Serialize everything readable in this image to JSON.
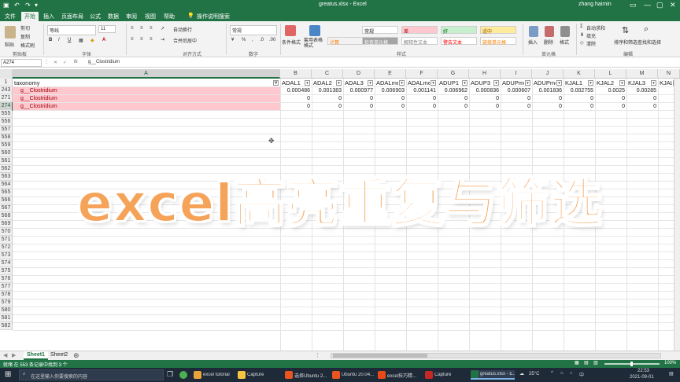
{
  "titlebar": {
    "document_title": "greatus.xlsx - Excel",
    "user": "zhang haimin"
  },
  "ribbon_tabs": [
    "文件",
    "开始",
    "插入",
    "页面布局",
    "公式",
    "数据",
    "审阅",
    "视图",
    "帮助",
    "操作说明搜索"
  ],
  "ribbon": {
    "clipboard_label": "剪贴板",
    "font_label": "字体",
    "align_label": "对齐方式",
    "number_label": "数字",
    "styles_label": "样式",
    "cells_label": "单元格",
    "edit_label": "编辑",
    "paste": "粘贴",
    "cut": "剪切",
    "copy": "复制",
    "format_painter": "格式刷",
    "font_name": "等线",
    "font_size": "11",
    "wrap_text": "自动换行",
    "merge_center": "合并后居中",
    "number_format": "常规",
    "conditional_format": "条件格式",
    "table_format": "套用表格格式",
    "styles": [
      {
        "label": "常规",
        "bg": "#ffffff",
        "fg": "#222222"
      },
      {
        "label": "差",
        "bg": "#ffc7ce",
        "fg": "#9c0006"
      },
      {
        "label": "好",
        "bg": "#c6efce",
        "fg": "#006100"
      },
      {
        "label": "适中",
        "bg": "#ffeb9c",
        "fg": "#9c5700"
      },
      {
        "label": "计算",
        "bg": "#f2f2f2",
        "fg": "#fa7d00"
      },
      {
        "label": "检查单元格",
        "bg": "#a5a5a5",
        "fg": "#ffffff"
      },
      {
        "label": "解释性文本",
        "bg": "#ffffff",
        "fg": "#7f7f7f"
      },
      {
        "label": "警告文本",
        "bg": "#ffffff",
        "fg": "#ff0000"
      },
      {
        "label": "链接单元格",
        "bg": "#ffffff",
        "fg": "#fa7d00"
      }
    ],
    "insert": "插入",
    "delete": "删除",
    "format": "格式",
    "autosum": "自动求和",
    "fill": "填充",
    "clear": "清除",
    "sort_filter": "排序和筛选",
    "find_select": "查找和选择"
  },
  "formula_bar": {
    "name_box": "A274",
    "fx": "fx",
    "formula": "g__Clostridium"
  },
  "columns": [
    {
      "letter": "A",
      "header": "taxonomy",
      "selected": true
    },
    {
      "letter": "B",
      "header": "ADAL1"
    },
    {
      "letter": "C",
      "header": "ADAL2"
    },
    {
      "letter": "D",
      "header": "ADAL3"
    },
    {
      "letter": "E",
      "header": "ADALme"
    },
    {
      "letter": "F",
      "header": "ADALme"
    },
    {
      "letter": "G",
      "header": "ADUP1"
    },
    {
      "letter": "H",
      "header": "ADUP3"
    },
    {
      "letter": "I",
      "header": "ADUPme"
    },
    {
      "letter": "J",
      "header": "ADUPme"
    },
    {
      "letter": "K",
      "header": "KJAL1"
    },
    {
      "letter": "L",
      "header": "KJAL2"
    },
    {
      "letter": "M",
      "header": "KJAL3"
    },
    {
      "letter": "N",
      "header": "KJAL"
    }
  ],
  "header_row_number": "1",
  "data_rows": [
    {
      "row": "243",
      "taxonomy": "g__Clostridium",
      "values": [
        "0.000486",
        "0.001383",
        "0.000977",
        "0.006903",
        "0.001141",
        "0.006962",
        "0.000836",
        "0.000607",
        "0.001836",
        "0.002755",
        "0.0025",
        "0.00285",
        ""
      ]
    },
    {
      "row": "271",
      "taxonomy": "g__Clostridium",
      "values": [
        "0",
        "0",
        "0",
        "0",
        "0",
        "0",
        "0",
        "0",
        "0",
        "0",
        "0",
        "0",
        ""
      ]
    },
    {
      "row": "274",
      "taxonomy": "g__Clostridium",
      "values": [
        "0",
        "0",
        "0",
        "0",
        "0",
        "0",
        "0",
        "0",
        "0",
        "0",
        "0",
        "0",
        ""
      ]
    }
  ],
  "empty_row_numbers": [
    "555",
    "556",
    "557",
    "558",
    "559",
    "560",
    "561",
    "562",
    "563",
    "564",
    "565",
    "566",
    "567",
    "568",
    "569",
    "570",
    "571",
    "572",
    "573",
    "574",
    "575",
    "576",
    "577",
    "578",
    "579",
    "580",
    "581",
    "582"
  ],
  "overlay_caption": "excel高亮重复与筛选",
  "sheets": [
    "Sheet1",
    "Sheet2"
  ],
  "status": {
    "left": "就绪  在 553 条记录中找到 3 个",
    "zoom": "100%"
  },
  "taskbar": {
    "search_placeholder": "在这里输入你要搜索的内容",
    "apps": [
      "excel tutorial",
      "Capture",
      "选择Ubuntu 2...",
      "Ubuntu 20.04...",
      "excel技巧精...",
      "Capture",
      "greatus.xlsx - E..."
    ],
    "weather": "25°C",
    "time": "22:53",
    "date": "2021-09-01"
  },
  "colors": {
    "excel_green": "#217346",
    "dup_fill": "#ffc7ce",
    "dup_text": "#9c0006",
    "caption": "#f6a35a"
  }
}
